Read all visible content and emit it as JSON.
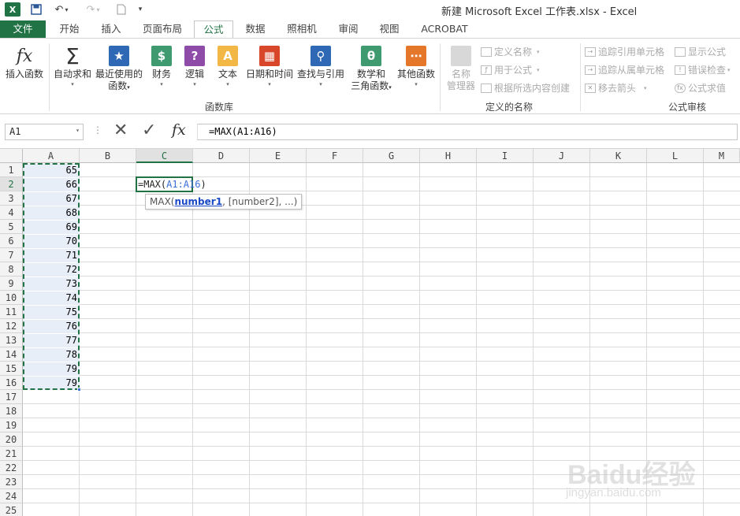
{
  "window": {
    "title": "新建 Microsoft Excel 工作表.xlsx - Excel"
  },
  "quick_access": {
    "logo_icon": "excel-logo-icon",
    "save_icon": "save-icon",
    "undo_icon": "undo-icon",
    "redo_icon": "redo-icon",
    "new_icon": "new-document-icon"
  },
  "tabs": [
    {
      "label": "文件"
    },
    {
      "label": "开始"
    },
    {
      "label": "插入"
    },
    {
      "label": "页面布局"
    },
    {
      "label": "公式"
    },
    {
      "label": "数据"
    },
    {
      "label": "照相机"
    },
    {
      "label": "审阅"
    },
    {
      "label": "视图"
    },
    {
      "label": "ACROBAT"
    }
  ],
  "ribbon": {
    "function_library": {
      "group_label": "函数库",
      "insert_function": "插入函数",
      "autosum": "自动求和",
      "recently_used_1": "最近使用的",
      "recently_used_2": "函数",
      "financial": "财务",
      "logical": "逻辑",
      "text": "文本",
      "date_time": "日期和时间",
      "lookup_reference": "查找与引用",
      "math_trig_1": "数学和",
      "math_trig_2": "三角函数",
      "more_functions": "其他函数"
    },
    "defined_names": {
      "group_label": "定义的名称",
      "name_manager_1": "名称",
      "name_manager_2": "管理器",
      "define_name": "定义名称",
      "use_in_formula": "用于公式",
      "create_from_selection": "根据所选内容创建"
    },
    "formula_auditing": {
      "group_label": "公式审核",
      "trace_precedents": "追踪引用单元格",
      "trace_dependents": "追踪从属单元格",
      "remove_arrows": "移去箭头",
      "show_formulas": "显示公式",
      "error_checking": "错误检查",
      "evaluate_formula": "公式求值"
    }
  },
  "formula_bar": {
    "name_box": "A1",
    "formula": "=MAX(A1:A16)"
  },
  "sheet": {
    "columns": [
      "A",
      "B",
      "C",
      "D",
      "E",
      "F",
      "G",
      "H",
      "I",
      "J",
      "K",
      "L",
      "M"
    ],
    "rows": [
      "1",
      "2",
      "3",
      "4",
      "5",
      "6",
      "7",
      "8",
      "9",
      "10",
      "11",
      "12",
      "13",
      "14",
      "15",
      "16",
      "17",
      "18",
      "19",
      "20",
      "21",
      "22",
      "23",
      "24",
      "25"
    ],
    "column_a_values": [
      "65",
      "66",
      "67",
      "68",
      "69",
      "70",
      "71",
      "72",
      "73",
      "74",
      "75",
      "76",
      "77",
      "78",
      "79",
      "79"
    ],
    "editing_cell": {
      "prefix": "=MAX(",
      "reference": "A1:A16",
      "suffix": ")"
    },
    "tooltip": {
      "func": "MAX(",
      "arg1": "number1",
      "rest": ", [number2], ...)"
    }
  },
  "watermark": {
    "main": "Baidu经验",
    "sub": "jingyan.baidu.com"
  },
  "colors": {
    "excel_green": "#217346",
    "reference_blue": "#3a6fd8",
    "selection_fill": "#e8eef8"
  }
}
